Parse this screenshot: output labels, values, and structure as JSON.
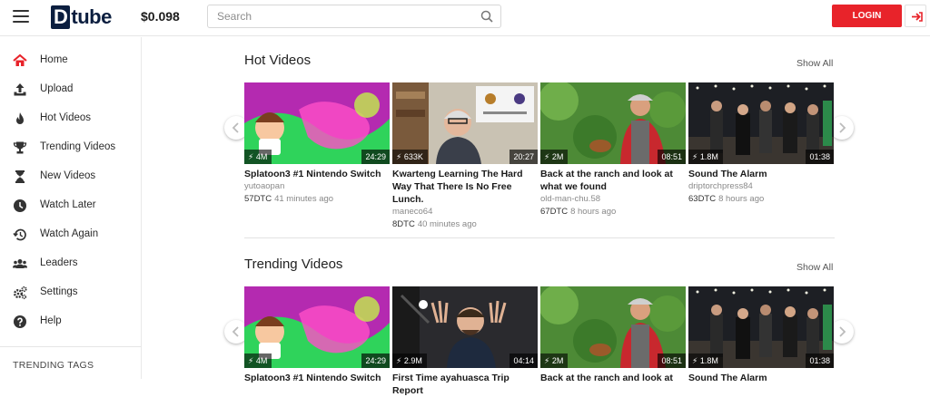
{
  "header": {
    "logo": "tube",
    "logo_initial": "D",
    "price": "$0.098",
    "search_placeholder": "Search",
    "login_label": "LOGIN"
  },
  "sidebar": {
    "items": [
      {
        "label": "Home",
        "icon": "home-icon"
      },
      {
        "label": "Upload",
        "icon": "upload-icon"
      },
      {
        "label": "Hot Videos",
        "icon": "flame-icon"
      },
      {
        "label": "Trending Videos",
        "icon": "trophy-icon"
      },
      {
        "label": "New Videos",
        "icon": "hourglass-icon"
      },
      {
        "label": "Watch Later",
        "icon": "clock-icon"
      },
      {
        "label": "Watch Again",
        "icon": "history-icon"
      },
      {
        "label": "Leaders",
        "icon": "users-icon"
      },
      {
        "label": "Settings",
        "icon": "cogs-icon"
      },
      {
        "label": "Help",
        "icon": "help-icon"
      }
    ],
    "trending_tags_label": "TRENDING TAGS"
  },
  "hot": {
    "title": "Hot Videos",
    "show_all": "Show All",
    "videos": [
      {
        "title": "Splatoon3 #1 Nintendo Switch",
        "author": "yutoaopan",
        "dtc": "57DTC",
        "ago": "41 minutes ago",
        "views": "4M",
        "duration": "24:29"
      },
      {
        "title": "Kwarteng Learning The Hard Way That There Is No Free Lunch.",
        "author": "maneco64",
        "dtc": "8DTC",
        "ago": "40 minutes ago",
        "views": "633K",
        "duration": "20:27"
      },
      {
        "title": "Back at the ranch and look at what we found",
        "author": "old-man-chu.58",
        "dtc": "67DTC",
        "ago": "8 hours ago",
        "views": "2M",
        "duration": "08:51"
      },
      {
        "title": "Sound The Alarm",
        "author": "driptorchpress84",
        "dtc": "63DTC",
        "ago": "8 hours ago",
        "views": "1.8M",
        "duration": "01:38"
      }
    ]
  },
  "trending": {
    "title": "Trending Videos",
    "show_all": "Show All",
    "videos": [
      {
        "title": "Splatoon3 #1 Nintendo Switch",
        "views": "4M",
        "duration": "24:29"
      },
      {
        "title": "First Time ayahuasca Trip Report",
        "views": "2.9M",
        "duration": "04:14"
      },
      {
        "title": "Back at the ranch and look at",
        "views": "2M",
        "duration": "08:51"
      },
      {
        "title": "Sound The Alarm",
        "views": "1.8M",
        "duration": "01:38"
      }
    ]
  },
  "colors": {
    "accent": "#e8232a",
    "brand": "#0b1e3f"
  }
}
